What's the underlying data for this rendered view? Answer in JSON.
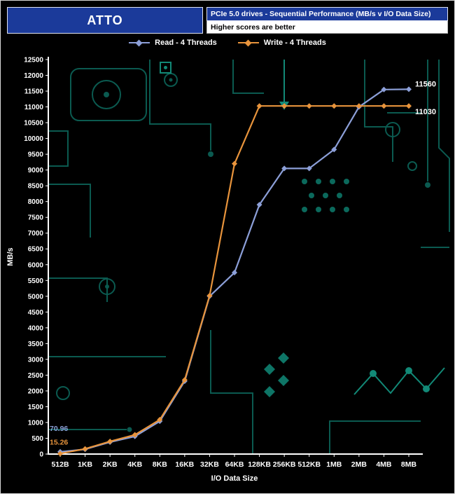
{
  "header": {
    "app_name": "ATTO",
    "title": "PCIe 5.0 drives - Sequential Performance (MB/s v I/O Data Size)",
    "subtitle": "Higher scores are better",
    "header_bg": "#1b3a9a",
    "subtitle_bg": "#ffffff"
  },
  "chart_data": {
    "type": "line",
    "title": "PCIe 5.0 drives - Sequential Performance (MB/s v I/O Data Size)",
    "note": "Higher scores are better",
    "xlabel": "I/O Data Size",
    "ylabel": "MB/s",
    "categories": [
      "512B",
      "1KB",
      "2KB",
      "4KB",
      "8KB",
      "16KB",
      "32KB",
      "64KB",
      "128KB",
      "256KB",
      "512KB",
      "1MB",
      "2MB",
      "4MB",
      "8MB"
    ],
    "ylim": [
      0,
      12500
    ],
    "y_tick_step": 500,
    "y_ticks": [
      0,
      500,
      1000,
      1500,
      2000,
      2500,
      3000,
      3500,
      4000,
      4500,
      5000,
      5500,
      6000,
      6500,
      7000,
      7500,
      8000,
      8500,
      9000,
      9500,
      10000,
      10500,
      11000,
      11500,
      12000,
      12500
    ],
    "grid": false,
    "legend_position": "top",
    "series": [
      {
        "name": "Read - 4 Threads",
        "color": "#8c9fd8",
        "values": [
          70.96,
          150,
          380,
          560,
          1040,
          2310,
          5000,
          5750,
          7900,
          9050,
          9050,
          9650,
          11000,
          11550,
          11560
        ],
        "start_label": "70.96",
        "end_label": "11560"
      },
      {
        "name": "Write - 4 Threads",
        "color": "#e8943c",
        "values": [
          15.26,
          165,
          400,
          610,
          1090,
          2350,
          5020,
          9200,
          11030,
          11030,
          11030,
          11030,
          11030,
          11030,
          11030
        ],
        "start_label": "15.26",
        "end_label": "11030"
      }
    ]
  }
}
